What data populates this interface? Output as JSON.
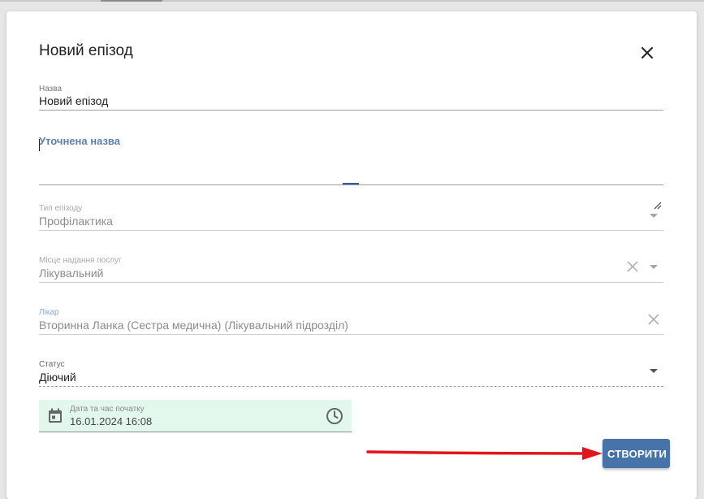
{
  "dialog": {
    "title": "Новий епізод",
    "close_icon": "close-icon"
  },
  "fields": {
    "name": {
      "label": "Назва",
      "value": "Новий епізод"
    },
    "refined_name": {
      "label": "Уточнена назва",
      "value": ""
    },
    "episode_type": {
      "label": "Тип епізоду",
      "value": "Профілактика",
      "icon": "chevron-down-icon"
    },
    "service_place": {
      "label": "Місце надання послуг",
      "value": "Лікувальний",
      "icons": [
        "clear-icon",
        "chevron-down-icon"
      ]
    },
    "doctor": {
      "label": "Лікар",
      "value": "Вторинна Ланка  (Сестра медична) (Лікувальний підрозділ)",
      "icon": "clear-icon"
    },
    "status": {
      "label": "Статус",
      "value": "Діючий",
      "icon": "chevron-down-icon"
    },
    "start_datetime": {
      "label": "Дата та час початку",
      "value": "16.01.2024 16:08",
      "icons": [
        "calendar-icon",
        "clock-icon"
      ]
    }
  },
  "actions": {
    "create_label": "СТВОРИТИ"
  },
  "colors": {
    "primary": "#4773a9",
    "date_field_bg": "#e3f8ec",
    "focus_label": "#5d7fae",
    "annotation_arrow": "#e3141b"
  }
}
